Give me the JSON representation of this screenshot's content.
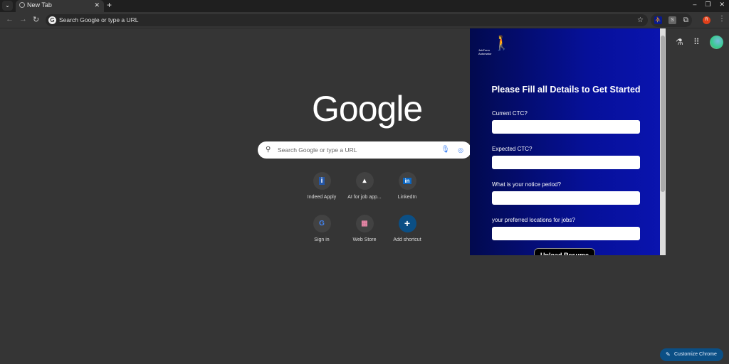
{
  "browser": {
    "tab_title": "New Tab",
    "omnibox_placeholder": "Search Google or type a URL",
    "profile_initial": "R",
    "ext_s": "S"
  },
  "ntp": {
    "logo": "Google",
    "search_placeholder": "Search Google or type a URL",
    "shortcuts": [
      {
        "label": "Indeed Apply",
        "icon": "i"
      },
      {
        "label": "AI for job app...",
        "icon": "▴"
      },
      {
        "label": "LinkedIn",
        "icon": "in"
      },
      {
        "label": "Sign in",
        "icon": "G"
      },
      {
        "label": "Web Store",
        "icon": "▦"
      },
      {
        "label": "Add shortcut",
        "icon": "+"
      }
    ],
    "customize": "Customize Chrome"
  },
  "extension_popup": {
    "logo_text_1": "JobForm",
    "logo_text_2": "Automator",
    "title": "Please Fill all Details to Get Started",
    "fields": [
      {
        "label": "Current CTC?",
        "value": ""
      },
      {
        "label": "Expected CTC?",
        "value": ""
      },
      {
        "label": "What is your notice period?",
        "value": ""
      },
      {
        "label": "your preferred locations for jobs?",
        "value": ""
      }
    ],
    "upload_button": "Upload Resume"
  }
}
